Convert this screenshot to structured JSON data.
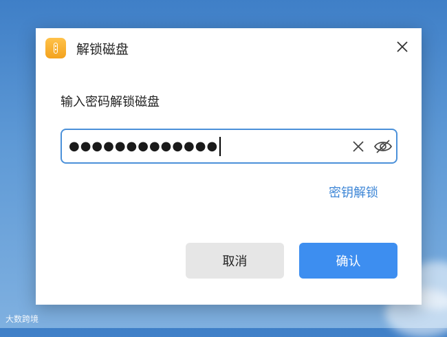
{
  "dialog": {
    "title": "解锁磁盘",
    "prompt": "输入密码解锁磁盘",
    "password_masked": "●●●●●●●●●●●●●",
    "key_unlock_link": "密钥解锁",
    "cancel_label": "取消",
    "confirm_label": "确认"
  },
  "watermark": {
    "text": "大数跨境"
  },
  "colors": {
    "accent": "#3d8ef0",
    "link": "#3d86d6",
    "input_border": "#4a90d9"
  },
  "icons": {
    "app": "zip-archive-icon",
    "close": "close-icon",
    "clear": "clear-icon",
    "visibility": "eye-hidden-icon"
  }
}
